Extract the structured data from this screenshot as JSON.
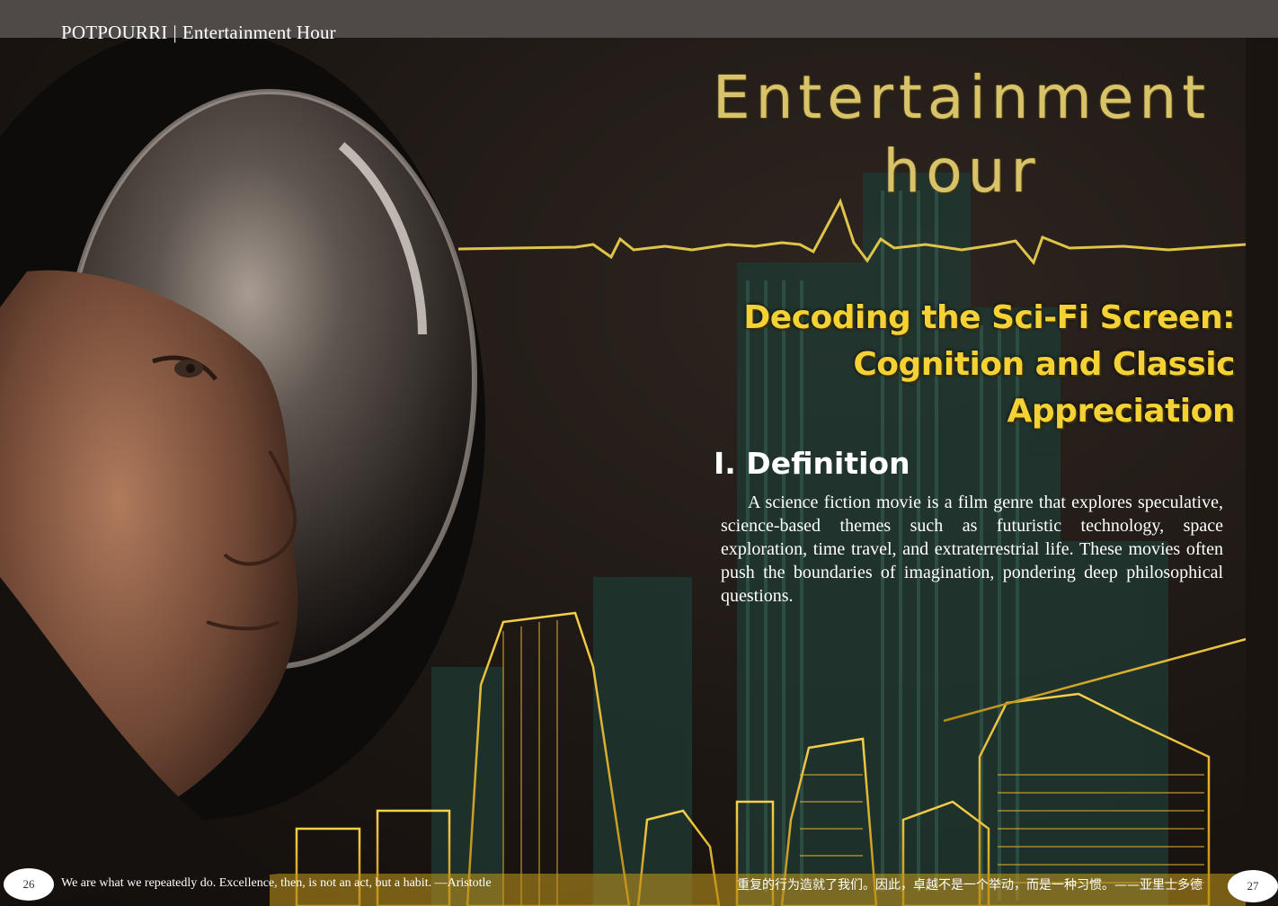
{
  "header": {
    "section": "POTPOURRI",
    "separator": "|",
    "column": "Entertainment Hour"
  },
  "title": {
    "line1": "Entertainment",
    "line2": "hour"
  },
  "subtitle": {
    "line1": "Decoding the Sci-Fi Screen:",
    "line2": "Cognition and Classic",
    "line3": "Appreciation"
  },
  "section": {
    "heading": "I. Definition",
    "body": "A science fiction movie is a film genre that explores speculative, science-based themes such as futuristic technology, space exploration, time travel, and extraterrestrial life. These movies often push the boundaries of imagination, pondering deep philosophical questions."
  },
  "footer": {
    "left_page": "26",
    "left_quote": "We are what we repeatedly do. Excellence, then, is not an act, but a habit. —Aristotle",
    "right_quote": "重复的行为造就了我们。因此，卓越不是一个举动，而是一种习惯。——亚里士多德",
    "right_page": "27"
  },
  "colors": {
    "gold": "#f4d236",
    "title_gold": "#d8c26a",
    "background": "#1c1612"
  }
}
